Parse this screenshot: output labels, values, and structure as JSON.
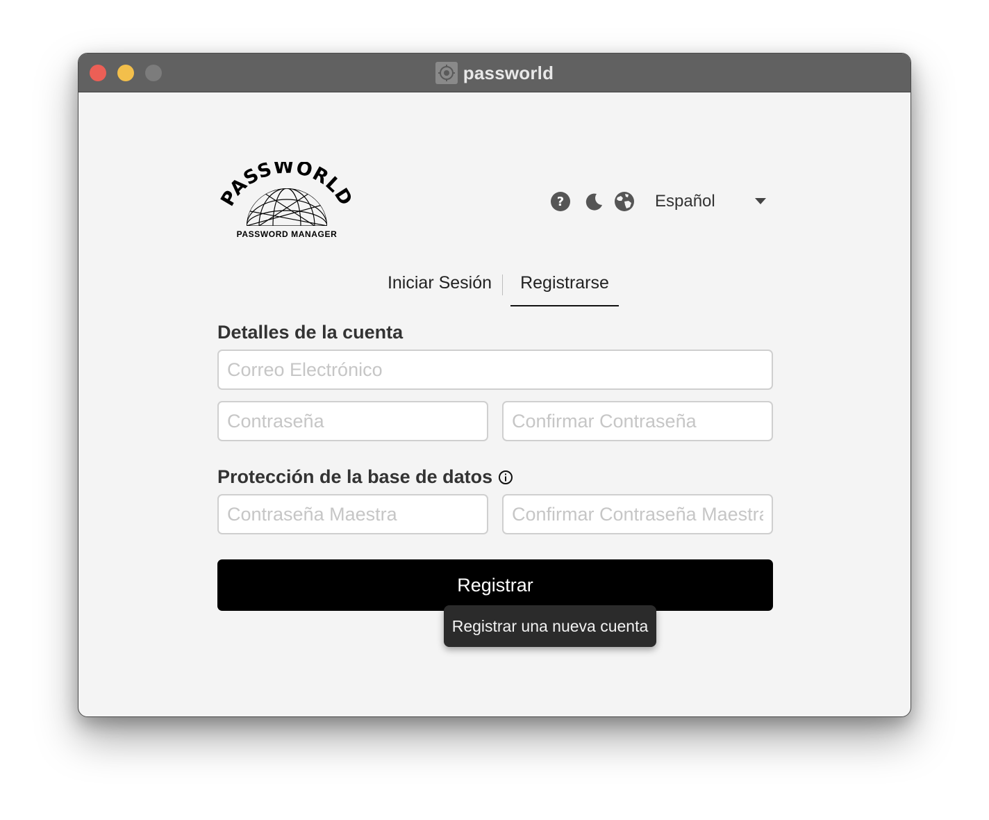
{
  "window": {
    "title": "passworld"
  },
  "brand": {
    "logo_word": "PASSWORLD",
    "logo_subtitle": "PASSWORD MANAGER"
  },
  "toolbar": {
    "help_icon": "help-icon",
    "theme_icon": "moon-icon",
    "language_icon": "globe-icon",
    "language_value": "Español"
  },
  "tabs": [
    {
      "label": "Iniciar Sesión",
      "active": false
    },
    {
      "label": "Registrarse",
      "active": true
    }
  ],
  "account_section": {
    "title": "Detalles de la cuenta",
    "email_placeholder": "Correo Electrónico",
    "password_placeholder": "Contraseña",
    "confirm_password_placeholder": "Confirmar Contraseña"
  },
  "database_section": {
    "title": "Protección de la base de datos",
    "master_password_placeholder": "Contraseña Maestra",
    "confirm_master_password_placeholder": "Confirmar Contraseña Maestra"
  },
  "register_button": {
    "label": "Registrar",
    "tooltip": "Registrar una nueva cuenta"
  },
  "colors": {
    "titlebar": "#616161",
    "background": "#f4f4f4",
    "primary_button": "#000000",
    "close": "#ec5f56",
    "minimize": "#f3bf4b"
  }
}
